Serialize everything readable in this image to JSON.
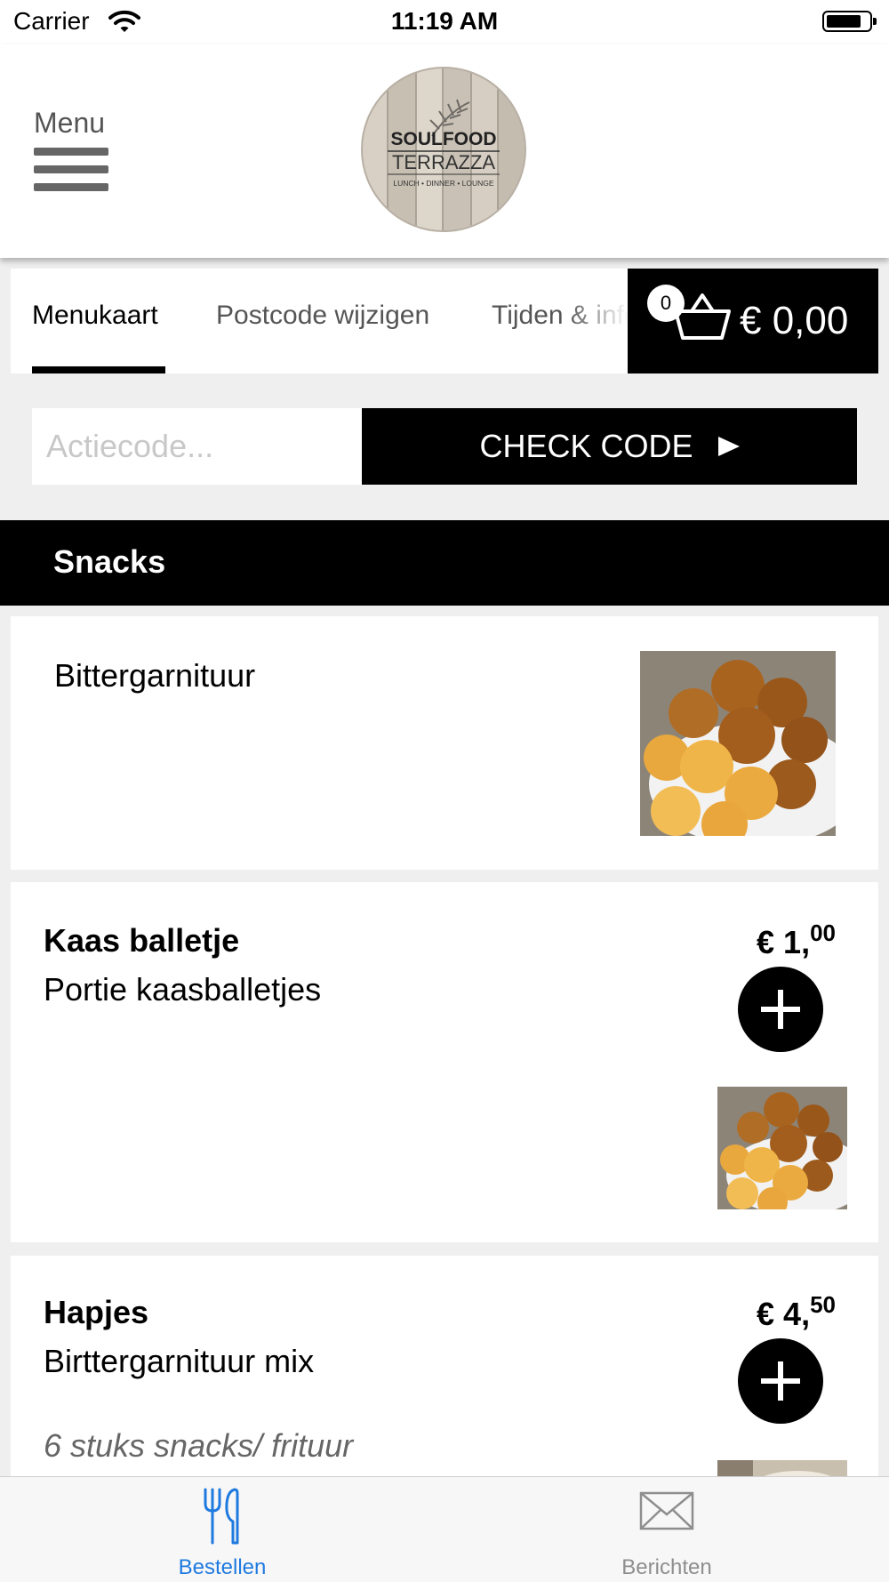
{
  "status": {
    "carrier": "Carrier",
    "time": "11:19 AM"
  },
  "header": {
    "menu_label": "Menu",
    "logo": {
      "line1": "SOULFOOD",
      "line2": "TERRAZZA",
      "line3": "LUNCH • DINNER • LOUNGE"
    }
  },
  "tabs": [
    {
      "label": "Menukaart",
      "active": true
    },
    {
      "label": "Postcode wijzigen",
      "active": false
    },
    {
      "label": "Tijden & info",
      "active": false
    }
  ],
  "cart": {
    "count": "0",
    "total": "€ 0,00"
  },
  "promo": {
    "placeholder": "Actiecode...",
    "button_label": "CHECK CODE"
  },
  "category": {
    "title": "Snacks"
  },
  "items": [
    {
      "title": "Bittergarnituur"
    },
    {
      "title": "Kaas balletje",
      "description": "Portie kaasballetjes",
      "price_main": "€ 1,",
      "price_cents": "00"
    },
    {
      "title": "Hapjes",
      "description": "Birttergarnituur mix",
      "note": "6 stuks snacks/ frituur",
      "price_main": "€ 4,",
      "price_cents": "50"
    }
  ],
  "tabbar": [
    {
      "label": "Bestellen",
      "icon": "fork-knife-icon",
      "active": true
    },
    {
      "label": "Berichten",
      "icon": "envelope-icon",
      "active": false
    }
  ],
  "colors": {
    "accent": "#1f7ae0",
    "inactive": "#8e8e8e",
    "black": "#000000",
    "background": "#efefef"
  }
}
